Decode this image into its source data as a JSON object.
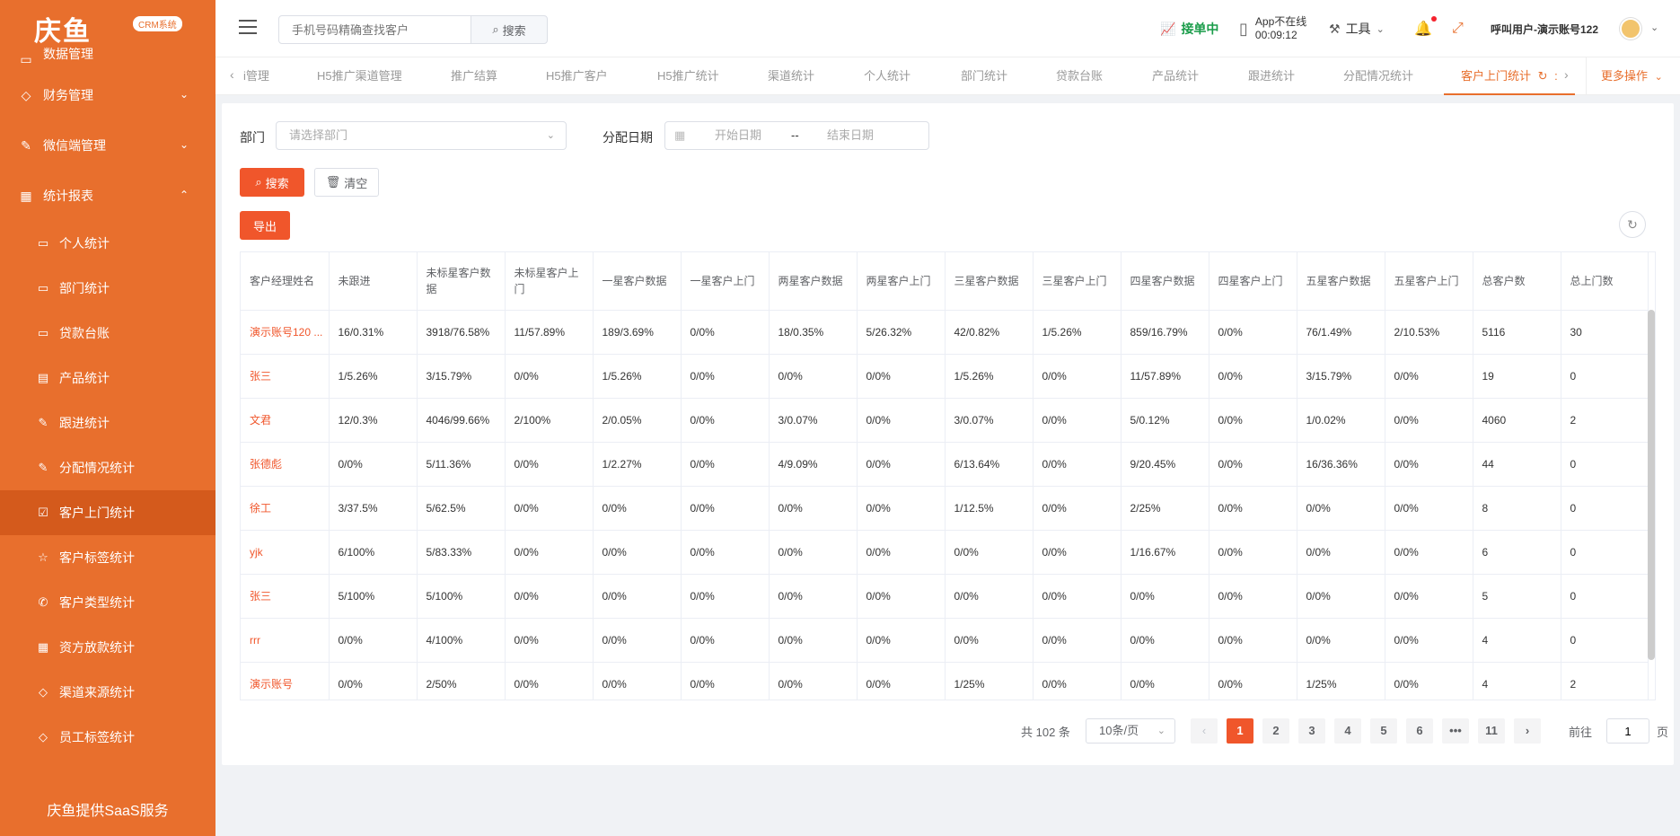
{
  "brand": {
    "name": "庆鱼",
    "badge": "CRM系统"
  },
  "sidebar": {
    "partial_label": "数据管理",
    "groups": [
      {
        "label": "财务管理",
        "chevron": "down"
      },
      {
        "label": "微信端管理",
        "chevron": "down"
      },
      {
        "label": "统计报表",
        "chevron": "up"
      }
    ],
    "items": [
      {
        "label": "个人统计",
        "icon": "monitor-icon"
      },
      {
        "label": "部门统计",
        "icon": "monitor-icon"
      },
      {
        "label": "贷款台账",
        "icon": "monitor-icon"
      },
      {
        "label": "产品统计",
        "icon": "document-icon"
      },
      {
        "label": "跟进统计",
        "icon": "edit-icon"
      },
      {
        "label": "分配情况统计",
        "icon": "edit-icon"
      },
      {
        "label": "客户上门统计",
        "icon": "checkbox-icon",
        "active": true
      },
      {
        "label": "客户标签统计",
        "icon": "star-icon"
      },
      {
        "label": "客户类型统计",
        "icon": "phone-icon"
      },
      {
        "label": "资方放款统计",
        "icon": "grid-icon"
      },
      {
        "label": "渠道来源统计",
        "icon": "tag-icon"
      },
      {
        "label": "员工标签统计",
        "icon": "tag-icon"
      }
    ],
    "footer": "庆鱼提供SaaS服务"
  },
  "header": {
    "search_placeholder": "手机号码精确查找客户",
    "search_button": "搜索",
    "accept_status": "接单中",
    "app_status_line1": "App不在线",
    "app_status_line2": "00:09:12",
    "tools_label": "工具",
    "user_label": "呼叫用户-演示账号122"
  },
  "tabs": {
    "items": [
      "i管理",
      "H5推广渠道管理",
      "推广结算",
      "H5推广客户",
      "H5推广统计",
      "渠道统计",
      "个人统计",
      "部门统计",
      "贷款台账",
      "产品统计",
      "跟进统计",
      "分配情况统计",
      "客户上门统计"
    ],
    "active_index": 12,
    "more_label": "更多操作"
  },
  "filters": {
    "dept_label": "部门",
    "dept_placeholder": "请选择部门",
    "date_label": "分配日期",
    "start_placeholder": "开始日期",
    "date_separator": "--",
    "end_placeholder": "结束日期",
    "search_button": "搜索",
    "clear_button": "清空",
    "export_button": "导出"
  },
  "table": {
    "columns": [
      "客户经理姓名",
      "未跟进",
      "未标星客户数据",
      "未标星客户上门",
      "一星客户数据",
      "一星客户上门",
      "两星客户数据",
      "两星客户上门",
      "三星客户数据",
      "三星客户上门",
      "四星客户数据",
      "四星客户上门",
      "五星客户数据",
      "五星客户上门",
      "总客户数",
      "总上门数"
    ],
    "rows": [
      [
        "演示账号120 ...",
        "16/0.31%",
        "3918/76.58%",
        "11/57.89%",
        "189/3.69%",
        "0/0%",
        "18/0.35%",
        "5/26.32%",
        "42/0.82%",
        "1/5.26%",
        "859/16.79%",
        "0/0%",
        "76/1.49%",
        "2/10.53%",
        "5116",
        "30"
      ],
      [
        "张三",
        "1/5.26%",
        "3/15.79%",
        "0/0%",
        "1/5.26%",
        "0/0%",
        "0/0%",
        "0/0%",
        "1/5.26%",
        "0/0%",
        "11/57.89%",
        "0/0%",
        "3/15.79%",
        "0/0%",
        "19",
        "0"
      ],
      [
        "文君",
        "12/0.3%",
        "4046/99.66%",
        "2/100%",
        "2/0.05%",
        "0/0%",
        "3/0.07%",
        "0/0%",
        "3/0.07%",
        "0/0%",
        "5/0.12%",
        "0/0%",
        "1/0.02%",
        "0/0%",
        "4060",
        "2"
      ],
      [
        "张德彪",
        "0/0%",
        "5/11.36%",
        "0/0%",
        "1/2.27%",
        "0/0%",
        "4/9.09%",
        "0/0%",
        "6/13.64%",
        "0/0%",
        "9/20.45%",
        "0/0%",
        "16/36.36%",
        "0/0%",
        "44",
        "0"
      ],
      [
        "徐工",
        "3/37.5%",
        "5/62.5%",
        "0/0%",
        "0/0%",
        "0/0%",
        "0/0%",
        "0/0%",
        "1/12.5%",
        "0/0%",
        "2/25%",
        "0/0%",
        "0/0%",
        "0/0%",
        "8",
        "0"
      ],
      [
        "yjk",
        "6/100%",
        "5/83.33%",
        "0/0%",
        "0/0%",
        "0/0%",
        "0/0%",
        "0/0%",
        "0/0%",
        "0/0%",
        "1/16.67%",
        "0/0%",
        "0/0%",
        "0/0%",
        "6",
        "0"
      ],
      [
        "张三",
        "5/100%",
        "5/100%",
        "0/0%",
        "0/0%",
        "0/0%",
        "0/0%",
        "0/0%",
        "0/0%",
        "0/0%",
        "0/0%",
        "0/0%",
        "0/0%",
        "0/0%",
        "5",
        "0"
      ],
      [
        "rrr",
        "0/0%",
        "4/100%",
        "0/0%",
        "0/0%",
        "0/0%",
        "0/0%",
        "0/0%",
        "0/0%",
        "0/0%",
        "0/0%",
        "0/0%",
        "0/0%",
        "0/0%",
        "4",
        "0"
      ],
      [
        "演示账号",
        "0/0%",
        "2/50%",
        "0/0%",
        "0/0%",
        "0/0%",
        "0/0%",
        "0/0%",
        "1/25%",
        "0/0%",
        "0/0%",
        "0/0%",
        "1/25%",
        "0/0%",
        "4",
        "2"
      ]
    ]
  },
  "pagination": {
    "total_label": "共 102 条",
    "page_size": "10条/页",
    "pages": [
      "1",
      "2",
      "3",
      "4",
      "5",
      "6",
      "•••",
      "11"
    ],
    "current": "1",
    "goto_label": "前往",
    "goto_value": "1",
    "page_suffix": "页"
  },
  "colors": {
    "brand": "#e86f2d",
    "primary_button": "#f0562b",
    "accept_green": "#1a9c4a"
  }
}
